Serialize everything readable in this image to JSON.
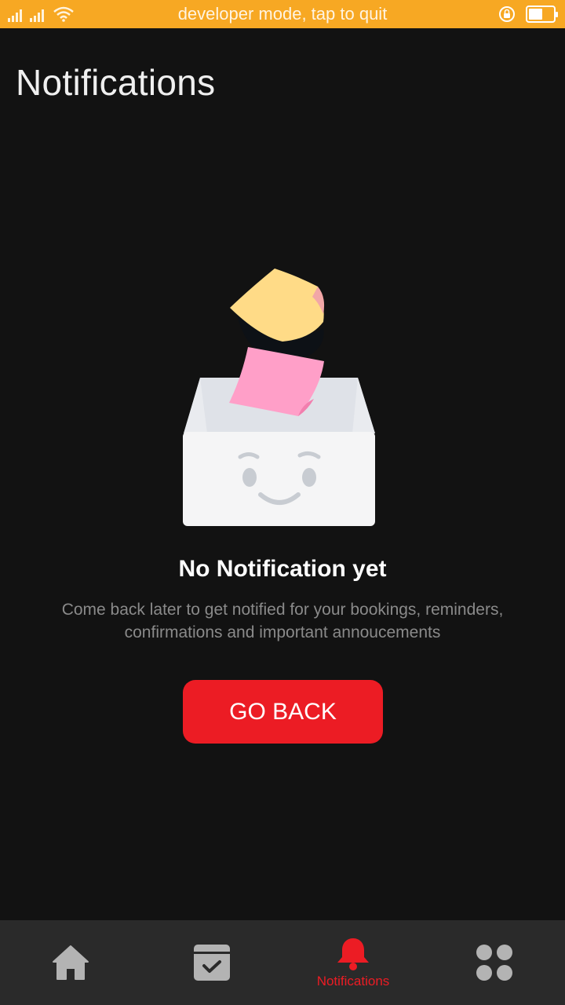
{
  "status_bar": {
    "text": "developer mode, tap to quit",
    "background": "#f7a823",
    "icons": [
      "signal-icon",
      "signal-icon",
      "wifi-icon",
      "rotation-lock-icon",
      "battery-icon"
    ]
  },
  "header": {
    "title": "Notifications"
  },
  "empty_state": {
    "illustration": "empty-box-illustration",
    "title": "No Notification yet",
    "description": "Come back later to get notified for your bookings, reminders, confirmations and important annoucements",
    "button_label": "GO BACK",
    "button_color": "#ec1c24"
  },
  "bottom_nav": {
    "items": [
      {
        "icon": "home-icon",
        "label": "",
        "active": false
      },
      {
        "icon": "calendar-check-icon",
        "label": "",
        "active": false
      },
      {
        "icon": "bell-icon",
        "label": "Notifications",
        "active": true
      },
      {
        "icon": "grid-icon",
        "label": "",
        "active": false
      }
    ],
    "active_color": "#ec1c24",
    "inactive_color": "#b3b3b3"
  }
}
